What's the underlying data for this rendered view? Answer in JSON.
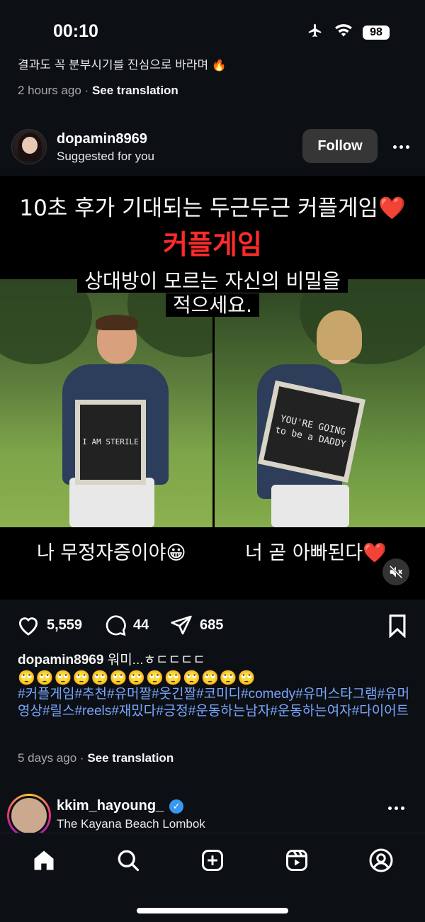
{
  "status_bar": {
    "time": "00:10",
    "battery": "98",
    "icons": [
      "airplane-icon",
      "wifi-icon",
      "battery-icon"
    ]
  },
  "previous_post": {
    "caption_fragment": "결과도 꼭 분부시기를 진심으로 바라며 🔥",
    "time": "2 hours ago",
    "separator": "·",
    "see_translation": "See translation"
  },
  "post": {
    "username": "dopamin8969",
    "subtitle": "Suggested for you",
    "follow_label": "Follow",
    "media": {
      "title_line1": "10초 후가 기대되는 두근두근 커플게임❤️",
      "title_line2": "커플게임",
      "prompt_line1": "상대방이 모르는 자신의 비밀을",
      "prompt_line2": "적으세요.",
      "sign_left": "I AM STERILE",
      "sign_right": "YOU'RE GOING to be a DADDY",
      "caption_left": "나 무정자증이야😀",
      "caption_right": "너 곧 아빠된다❤️"
    },
    "likes": "5,559",
    "comments": "44",
    "shares": "685",
    "caption_username": "dopamin8969",
    "caption_text": "워미...ㅎㄷㄷㄷㄷ",
    "caption_emojis": "🙄🙄🙄🙄🙄🙄🙄🙄🙄🙄🙄🙄🙄",
    "hashtags": "#커플게임#추천#유머짤#웃긴짤#코미디#comedy#유머스타그램#유머영상#릴스#reels#재밌다#긍정#운동하는남자#운동하는여자#다이어트",
    "time": "5 days ago",
    "separator": "·",
    "see_translation": "See translation"
  },
  "next_post": {
    "username": "kkim_hayoung_",
    "verified": "✓",
    "location": "The Kayana Beach Lombok"
  },
  "tabbar": {
    "tabs": [
      "home-icon",
      "search-icon",
      "create-icon",
      "reels-icon",
      "profile-icon"
    ]
  },
  "colors": {
    "background": "#0c1014",
    "hashtag": "#7aa6ff",
    "title_red": "#ff2a2a",
    "verified": "#3897f0"
  }
}
